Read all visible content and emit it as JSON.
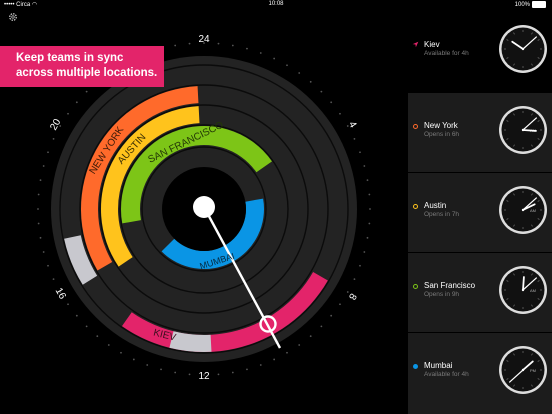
{
  "status": {
    "carrier": "Circa",
    "time": "10:08",
    "battery": "100%"
  },
  "banner": {
    "line1": "Keep teams in sync",
    "line2": "across multiple locations."
  },
  "dial": {
    "hour_labels": [
      "24",
      "4",
      "8",
      "12",
      "16",
      "20"
    ],
    "bands": [
      "KIEV",
      "NEW YORK",
      "AUSTIN",
      "SAN FRANCISCO",
      "MUMBAI"
    ],
    "colors": {
      "kiev": "#e3246a",
      "newyork": "#ff6a2b",
      "austin": "#ffc31c",
      "sanfrancisco": "#7dc517",
      "mumbai": "#0a95e5",
      "gray": "#c8c8ce"
    }
  },
  "locations": [
    {
      "name": "Kiev",
      "status": "Available for 4h",
      "indicator": "location-arrow-icon",
      "color": "#e3246a",
      "hour": 10,
      "minute": 8,
      "clock_label": ""
    },
    {
      "name": "New York",
      "status": "Opens in 6h",
      "indicator": "ring",
      "color": "#ff6a2b",
      "hour": 3,
      "minute": 8,
      "clock_label": "AM"
    },
    {
      "name": "Austin",
      "status": "Opens in 7h",
      "indicator": "ring",
      "color": "#ffc31c",
      "hour": 2,
      "minute": 8,
      "clock_label": "AM"
    },
    {
      "name": "San Francisco",
      "status": "Opens in 9h",
      "indicator": "ring",
      "color": "#7dc517",
      "hour": 12,
      "minute": 8,
      "clock_label": "AM"
    },
    {
      "name": "Mumbai",
      "status": "Available for 4h",
      "indicator": "dot",
      "color": "#0a95e5",
      "hour": 1,
      "minute": 38,
      "clock_label": "PM"
    }
  ]
}
